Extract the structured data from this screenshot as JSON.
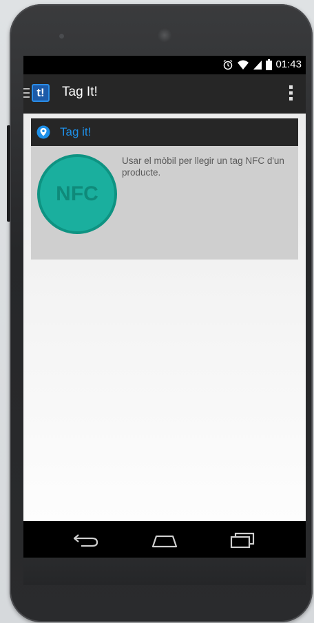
{
  "status_bar": {
    "time": "01:43",
    "icons": [
      "alarm-icon",
      "wifi-icon",
      "signal-icon",
      "battery-icon"
    ]
  },
  "action_bar": {
    "logo_text": "t!",
    "title": "Tag It!",
    "icons": [
      "drawer-icon",
      "overflow-menu-icon"
    ]
  },
  "card": {
    "title": "Tag it!",
    "badge_text": "NFC",
    "description": "Usar el mòbil per llegir un tag NFC d'un producte.",
    "header_icon": "location-pin-icon"
  },
  "nav_bar": {
    "icons": [
      "back-icon",
      "home-icon",
      "recent-apps-icon"
    ]
  },
  "colors": {
    "accent": "#1e90e8",
    "nfc_green": "#1aaf9e",
    "card_bg": "#cfcfcf",
    "bar_bg": "#262626"
  }
}
